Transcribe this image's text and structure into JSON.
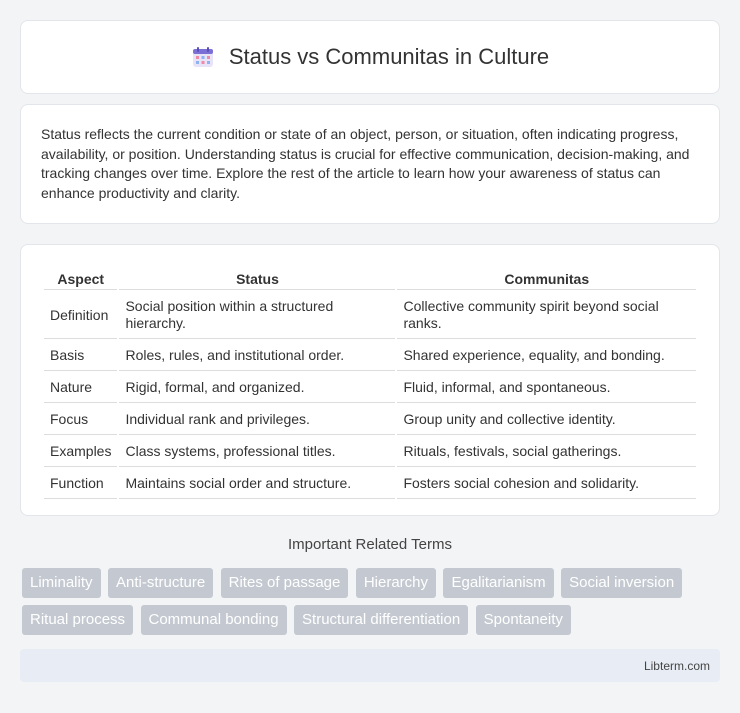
{
  "header": {
    "title": "Status vs Communitas in Culture",
    "icon": "calendar-icon"
  },
  "intro": {
    "text": "Status reflects the current condition or state of an object, person, or situation, often indicating progress, availability, or position. Understanding status is crucial for effective communication, decision-making, and tracking changes over time. Explore the rest of the article to learn how your awareness of status can enhance productivity and clarity."
  },
  "table": {
    "headers": [
      "Aspect",
      "Status",
      "Communitas"
    ],
    "rows": [
      [
        "Definition",
        "Social position within a structured hierarchy.",
        "Collective community spirit beyond social ranks."
      ],
      [
        "Basis",
        "Roles, rules, and institutional order.",
        "Shared experience, equality, and bonding."
      ],
      [
        "Nature",
        "Rigid, formal, and organized.",
        "Fluid, informal, and spontaneous."
      ],
      [
        "Focus",
        "Individual rank and privileges.",
        "Group unity and collective identity."
      ],
      [
        "Examples",
        "Class systems, professional titles.",
        "Rituals, festivals, social gatherings."
      ],
      [
        "Function",
        "Maintains social order and structure.",
        "Fosters social cohesion and solidarity."
      ]
    ]
  },
  "related": {
    "title": "Important Related Terms",
    "tags": [
      "Liminality",
      "Anti-structure",
      "Rites of passage",
      "Hierarchy",
      "Egalitarianism",
      "Social inversion",
      "Ritual process",
      "Communal bonding",
      "Structural differentiation",
      "Spontaneity"
    ]
  },
  "footer": {
    "text": "Libterm.com"
  }
}
